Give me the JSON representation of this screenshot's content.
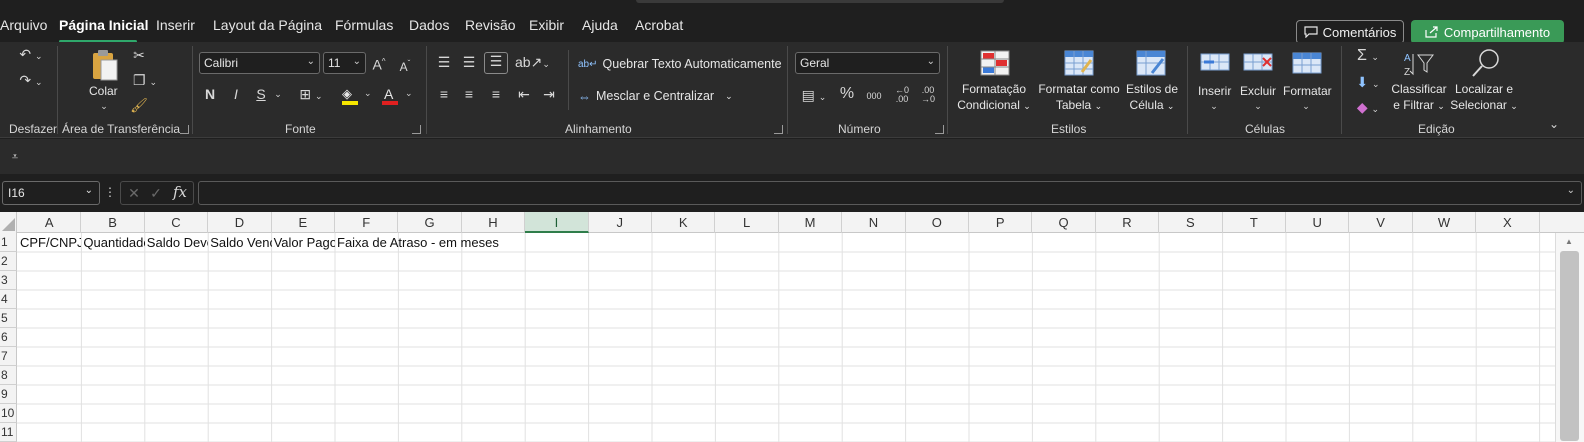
{
  "menu": {
    "tabs": [
      {
        "label": "Arquivo"
      },
      {
        "label": "Página Inicial"
      },
      {
        "label": "Inserir"
      },
      {
        "label": "Layout da Página"
      },
      {
        "label": "Fórmulas"
      },
      {
        "label": "Dados"
      },
      {
        "label": "Revisão"
      },
      {
        "label": "Exibir"
      },
      {
        "label": "Ajuda"
      },
      {
        "label": "Acrobat"
      }
    ],
    "active_tab": "Página Inicial",
    "comments_label": "Comentários",
    "share_label": "Compartilhamento"
  },
  "ribbon": {
    "groups": {
      "undo": "Desfazer",
      "clipboard": "Área de Transferência",
      "font": "Fonte",
      "alignment": "Alinhamento",
      "number": "Número",
      "styles": "Estilos",
      "cells": "Células",
      "editing": "Edição"
    },
    "paste_label": "Colar",
    "font_name": "Calibri",
    "font_size": "11",
    "bold": "N",
    "italic": "I",
    "underline": "S",
    "wrap_text": "Quebrar Texto Automaticamente",
    "merge_center": "Mesclar e Centralizar",
    "number_format": "Geral",
    "percent": "%",
    "thousands": "000",
    "conditional_format": [
      "Formatação",
      "Condicional"
    ],
    "format_table": [
      "Formatar como",
      "Tabela"
    ],
    "cell_styles": [
      "Estilos de",
      "Célula"
    ],
    "insert": "Inserir",
    "delete": "Excluir",
    "format": "Formatar",
    "sort_filter": [
      "Classificar",
      "e Filtrar"
    ],
    "find_select": [
      "Localizar e",
      "Selecionar"
    ]
  },
  "formula_bar": {
    "name_box": "I16",
    "fx": "fx",
    "formula": ""
  },
  "sheet": {
    "columns": [
      "A",
      "B",
      "C",
      "D",
      "E",
      "F",
      "G",
      "H",
      "I",
      "J",
      "K",
      "L",
      "M",
      "N",
      "O",
      "P",
      "Q",
      "R",
      "S",
      "T",
      "U",
      "V",
      "W",
      "X"
    ],
    "selected_column": "I",
    "rows": [
      "1",
      "2",
      "3",
      "4",
      "5",
      "6",
      "7",
      "8",
      "9",
      "10",
      "11"
    ],
    "row1_cells": {
      "A": "CPF/CNPJ",
      "B": "Quantidade",
      "C": "Saldo Devedor",
      "D": "Saldo Vencido",
      "E": "Valor Pago",
      "F": "Faixa de Atraso - em meses"
    }
  },
  "colors": {
    "accent_green": "#2fa86b",
    "share_button": "#3a9a57",
    "ribbon_bg": "#2b2b2b",
    "app_bg": "#1f1f1f"
  }
}
